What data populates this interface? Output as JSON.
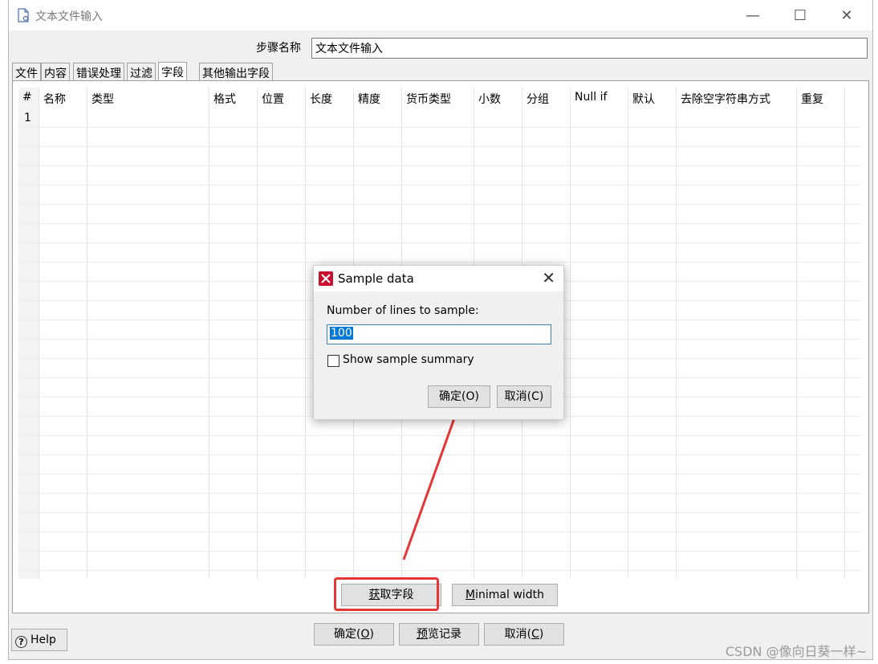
{
  "window": {
    "title": "文本文件输入",
    "controls": {
      "minimize": "—",
      "maximize": "☐",
      "close": "✕"
    }
  },
  "step": {
    "label": "步骤名称",
    "value": "文本文件输入"
  },
  "tabs": [
    {
      "label": "文件"
    },
    {
      "label": "内容"
    },
    {
      "label": "错误处理"
    },
    {
      "label": "过滤"
    },
    {
      "label": "字段",
      "active": true
    },
    {
      "label": "其他输出字段"
    }
  ],
  "grid": {
    "rownum_header": "#",
    "columns": [
      "名称",
      "类型",
      "格式",
      "位置",
      "长度",
      "精度",
      "货币类型",
      "小数",
      "分组",
      "Null if",
      "默认",
      "去除空字符串方式",
      "重复"
    ],
    "rows": [
      "1"
    ]
  },
  "panel_buttons": {
    "get_fields": {
      "hotkey": "获",
      "rest": "取字段"
    },
    "minimal_width": {
      "hotkey": "M",
      "rest": "inimal width"
    }
  },
  "bottom_buttons": {
    "ok": {
      "text": "确定(",
      "hotkey": "O",
      "end": ")"
    },
    "preview": {
      "hotkey": "预",
      "rest": "览记录"
    },
    "cancel": {
      "text": "取消(",
      "hotkey": "C",
      "end": ")"
    }
  },
  "help": {
    "label": "Help",
    "icon": "?"
  },
  "dialog": {
    "title": "Sample data",
    "label": "Number of lines to sample:",
    "value": "100",
    "checkbox_label": "Show sample summary",
    "ok": "确定(O)",
    "cancel": "取消(C)"
  },
  "watermark": "CSDN @像向日葵一样~",
  "colors": {
    "annotation": "#e53535",
    "selection": "#0078d7"
  }
}
